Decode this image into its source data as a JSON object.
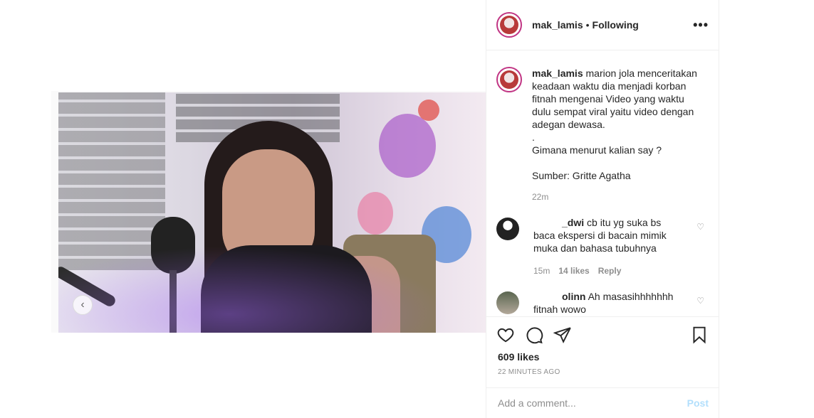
{
  "header": {
    "username": "mak_lamis",
    "separator": "•",
    "follow_status": "Following",
    "more_icon": "•••"
  },
  "caption": {
    "username": "mak_lamis",
    "text": "marion jola menceritakan keadaan waktu dia menjadi korban fitnah mengenai Video yang waktu dulu sempat viral yaitu video dengan adegan dewasa.\n.\nGimana menurut kalian say ?\n\nSumber: Gritte Agatha",
    "time": "22m"
  },
  "comments": [
    {
      "username": "_dwi",
      "text": "cb itu yg suka bs baca ekspersi di bacain mimik muka dan bahasa tubuhnya",
      "time": "15m",
      "likes": "14 likes",
      "reply_label": "Reply"
    },
    {
      "username": "olinn",
      "text": "Ah masasihhhhhhh fitnah wowo"
    }
  ],
  "media": {
    "prev_icon": "‹"
  },
  "actions": {
    "likes": "609 likes",
    "timestamp": "22 MINUTES AGO"
  },
  "add_comment": {
    "placeholder": "Add a comment...",
    "post_label": "Post"
  },
  "colors": {
    "accent_link": "#b2dffc",
    "border": "#efefef",
    "text": "#262626",
    "muted": "#8e8e8e"
  }
}
